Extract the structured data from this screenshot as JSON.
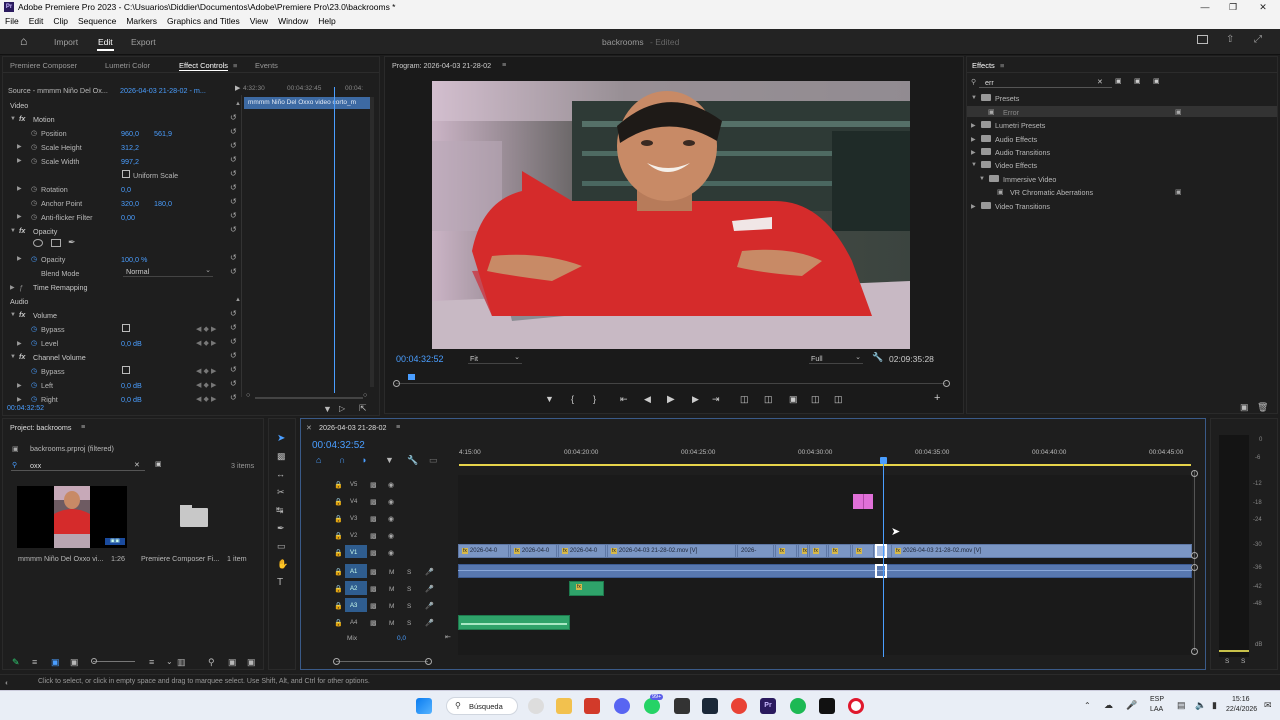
{
  "window": {
    "title": "Adobe Premiere Pro 2023 - C:\\Usuarios\\Diddier\\Documentos\\Adobe\\Premiere Pro\\23.0\\backrooms *",
    "app_badge": "Pr"
  },
  "menu": [
    "File",
    "Edit",
    "Clip",
    "Sequence",
    "Markers",
    "Graphics and Titles",
    "View",
    "Window",
    "Help"
  ],
  "workspace": {
    "tabs": [
      "Import",
      "Edit",
      "Export"
    ],
    "active": "Edit",
    "project": "backrooms",
    "state": "- Edited"
  },
  "left_panel": {
    "tabs": [
      "Premiere Composer",
      "Lumetri Color",
      "Effect Controls",
      "Events"
    ],
    "source": "Source - mmmm Niño Del Ox...",
    "sequence": "2026-04-03 21-28-02 - m...",
    "times": [
      "4:32:30",
      "00:04:32:45",
      "00:04:"
    ],
    "clip_label": "mmmm Niño Del Oxxo video corto_m",
    "video_hdr": "Video",
    "audio_hdr": "Audio",
    "motion": "Motion",
    "position_lbl": "Position",
    "position_x": "960,0",
    "position_y": "561,9",
    "scale_h_lbl": "Scale Height",
    "scale_h": "312,2",
    "scale_w_lbl": "Scale Width",
    "scale_w": "997,2",
    "uniform_lbl": "Uniform Scale",
    "rotation_lbl": "Rotation",
    "rotation": "0,0",
    "anchor_lbl": "Anchor Point",
    "anchor_x": "320,0",
    "anchor_y": "180,0",
    "antiflicker_lbl": "Anti-flicker Filter",
    "antiflicker": "0,00",
    "opacity_sect": "Opacity",
    "opacity_lbl": "Opacity",
    "opacity": "100,0 %",
    "blend_lbl": "Blend Mode",
    "blend": "Normal",
    "timeremap": "Time Remapping",
    "volume": "Volume",
    "bypass_lbl": "Bypass",
    "level_lbl": "Level",
    "level": "0,0 dB",
    "chanvol": "Channel Volume",
    "bypass2_lbl": "Bypass",
    "left_lbl": "Left",
    "left": "0,0 dB",
    "right_lbl": "Right",
    "right": "0,0 dB",
    "timecode": "00:04:32:52"
  },
  "program": {
    "title": "Program: 2026-04-03 21-28-02",
    "timecode": "00:04:32:52",
    "fit": "Fit",
    "quality": "Full",
    "duration": "02:09:35:28"
  },
  "effects": {
    "title": "Effects",
    "search": "err",
    "tree": [
      "Presets",
      "Error",
      "Lumetri Presets",
      "Audio Effects",
      "Audio Transitions",
      "Video Effects",
      "Immersive Video",
      "VR Chromatic Aberrations",
      "Video Transitions"
    ]
  },
  "project": {
    "title": "Project: backrooms",
    "file": "backrooms.prproj (filtered)",
    "search": "oxx",
    "count": "3 items",
    "item1_name": "mmmm Niño Del Oxxo vi...",
    "item1_dur": "1:26",
    "item2_name": "Premiere Composer Fi...",
    "item2_count": "1 item"
  },
  "timeline": {
    "title": "2026-04-03 21-28-02",
    "timecode": "00:04:32:52",
    "ruler": [
      "4:15:00",
      "00:04:20:00",
      "00:04:25:00",
      "00:04:30:00",
      "00:04:35:00",
      "00:04:40:00",
      "00:04:45:00"
    ],
    "tracks": [
      "V5",
      "V4",
      "V3",
      "V2",
      "V1",
      "A1",
      "A2",
      "A3",
      "A4"
    ],
    "mix_lbl": "Mix",
    "mix_val": "0,0",
    "clips": [
      "2026-04-0",
      "2026-04-0",
      "2026-04-0",
      "2026-04-03 21-28-02.mov [V]",
      "2026-",
      "2026-04-03 21-28-02.mov [V]"
    ]
  },
  "meters": {
    "scale": [
      "0",
      "-6",
      "-12",
      "-18",
      "-24",
      "-30",
      "-36",
      "-42",
      "-48",
      "dB"
    ],
    "solo": [
      "S",
      "S"
    ]
  },
  "status": "Click to select, or click in empty space and drag to marquee select. Use Shift, Alt, and Ctrl for other options.",
  "taskbar": {
    "search": "Búsqueda",
    "lang": "ESP",
    "lang2": "LAA",
    "time": "15:16",
    "date": "22/4/2026",
    "badge": "99+"
  }
}
